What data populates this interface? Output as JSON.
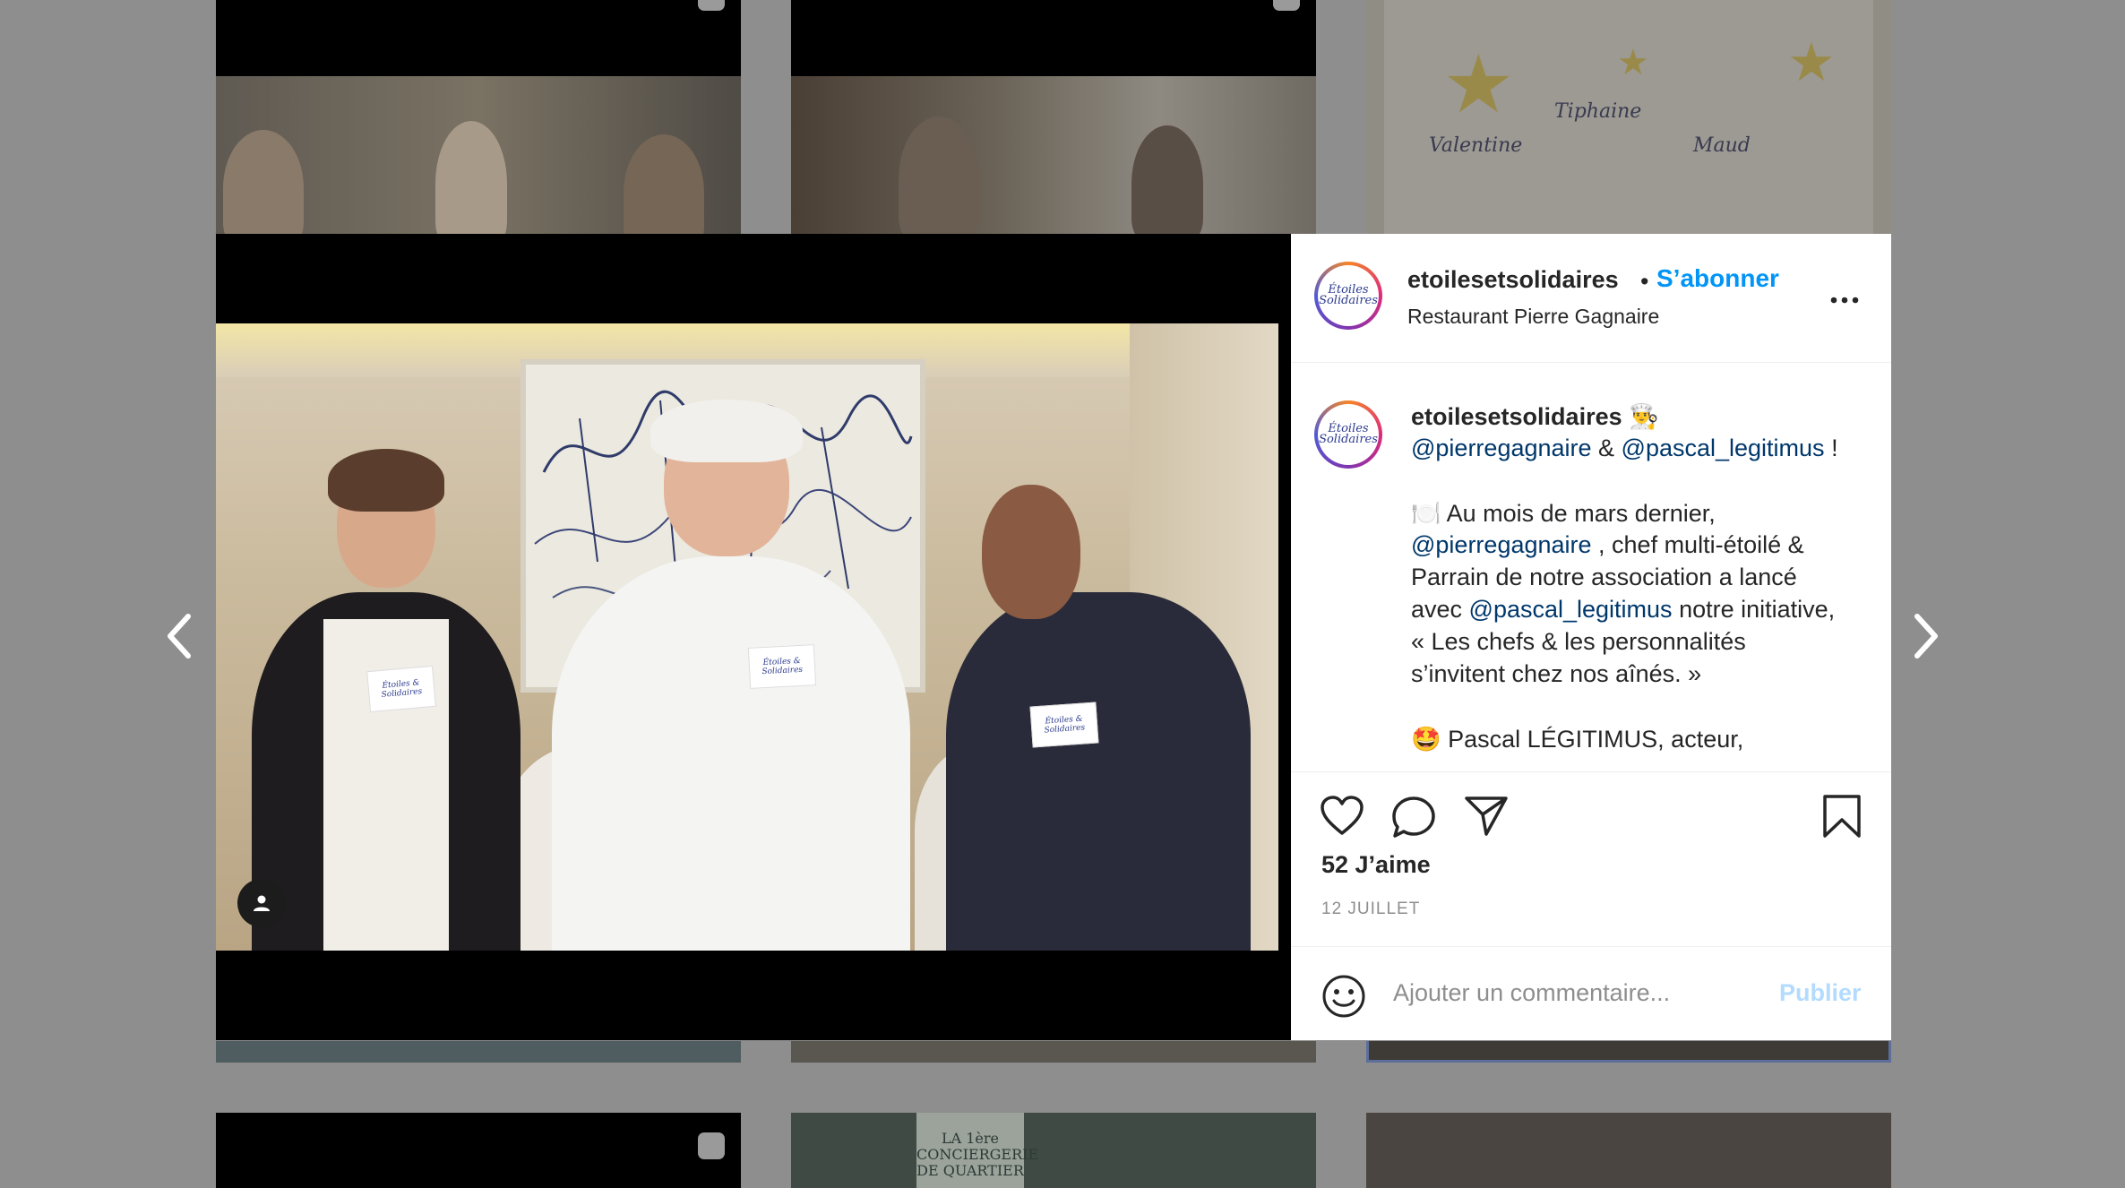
{
  "post": {
    "username": "etoilesetsolidaires",
    "dot": "•",
    "follow_label": "S’abonner",
    "location": "Restaurant Pierre Gagnaire",
    "more_label": "•••",
    "avatar_text_line1": "Étoiles",
    "avatar_text_line2": "Solidaires"
  },
  "caption": {
    "line1_user": "etoilesetsolidaires",
    "line1_emoji": "👨‍🍳",
    "line2_mention1": "@pierregagnaire",
    "line2_amp": " & ",
    "line2_mention2": "@pascal_legitimus",
    "line2_end": " !",
    "line3": "🍽️ Au mois de mars dernier,",
    "line4_mention": "@pierregagnaire",
    "line4_rest": " , chef multi-étoilé &",
    "line5": "Parrain de notre association a lancé",
    "line6_start": "avec ",
    "line6_mention": "@pascal_legitimus",
    "line6_rest": " notre initiative,",
    "line7": "« Les chefs & les personnalités",
    "line8": "s’invitent chez nos aînés. »",
    "line9": "🤩 Pascal LÉGITIMUS, acteur,"
  },
  "actions": {
    "likes": "52 J’aime",
    "date": "12 JUILLET"
  },
  "comment": {
    "placeholder": "Ajouter un commentaire...",
    "publish_label": "Publier"
  },
  "photo": {
    "card1": "Étoiles & Solidaires",
    "card2": "Étoiles & Solidaires",
    "card3": "Étoiles & Solidaires"
  },
  "background_tile": {
    "names": [
      "Valentine",
      "Tiphaine",
      "Maud"
    ],
    "sign_line1": "LA 1ère",
    "sign_line2": "CONCIERGERIE",
    "sign_line3": "DE QUARTIER"
  },
  "colors": {
    "follow": "#0095f6",
    "mention": "#00376b",
    "publish_disabled": "#b3dbff",
    "overlay": "#8e8e8e"
  }
}
